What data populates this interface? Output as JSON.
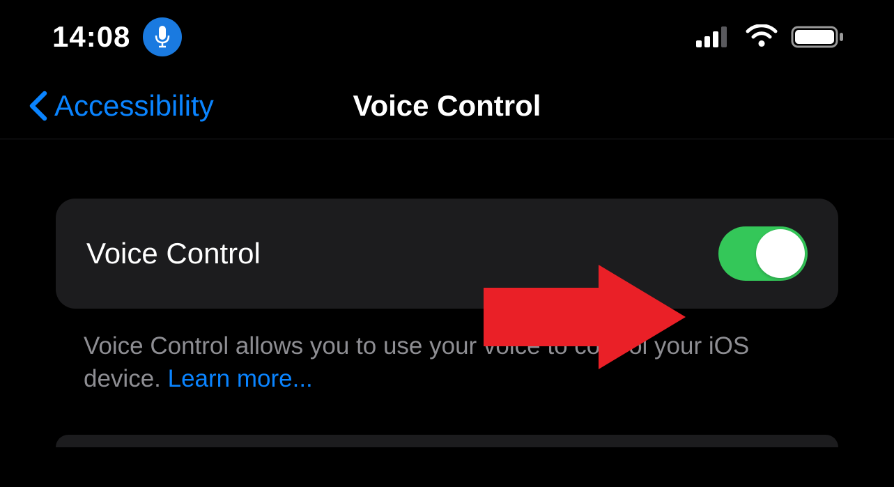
{
  "statusBar": {
    "time": "14:08"
  },
  "navBar": {
    "backLabel": "Accessibility",
    "title": "Voice Control"
  },
  "settings": {
    "voiceControl": {
      "label": "Voice Control",
      "enabled": true
    }
  },
  "description": {
    "text": "Voice Control allows you to use your voice to control your iOS device. ",
    "learnMore": "Learn more..."
  },
  "colors": {
    "accent": "#0a84ff",
    "toggleOn": "#34c759",
    "micPill": "#1a7ae0",
    "cellBackground": "#1c1c1e",
    "secondaryText": "#8e8e93",
    "annotationArrow": "#ea2027"
  }
}
